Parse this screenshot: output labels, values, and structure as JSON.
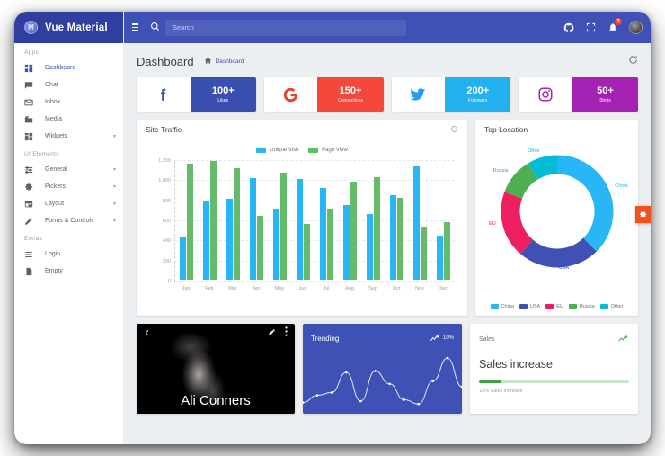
{
  "brand": {
    "logo_letter": "M",
    "title": "Vue Material"
  },
  "sidebar": {
    "sections": [
      {
        "label": "Apps",
        "items": [
          {
            "label": "Dashboard",
            "icon": "dashboard-icon",
            "active": true,
            "expandable": false
          },
          {
            "label": "Chat",
            "icon": "chat-icon",
            "active": false,
            "expandable": false
          },
          {
            "label": "Inbox",
            "icon": "inbox-icon",
            "active": false,
            "expandable": false
          },
          {
            "label": "Media",
            "icon": "media-icon",
            "active": false,
            "expandable": false
          },
          {
            "label": "Widgets",
            "icon": "widgets-icon",
            "active": false,
            "expandable": true
          }
        ]
      },
      {
        "label": "UI Elements",
        "items": [
          {
            "label": "General",
            "icon": "tune-icon",
            "active": false,
            "expandable": true
          },
          {
            "label": "Pickers",
            "icon": "gear-icon",
            "active": false,
            "expandable": true
          },
          {
            "label": "Layout",
            "icon": "layout-icon",
            "active": false,
            "expandable": true
          },
          {
            "label": "Forms & Controls",
            "icon": "pencil-icon",
            "active": false,
            "expandable": true
          }
        ]
      },
      {
        "label": "Extras",
        "items": [
          {
            "label": "Login",
            "icon": "list-icon",
            "active": false,
            "expandable": false
          },
          {
            "label": "Empty",
            "icon": "page-icon",
            "active": false,
            "expandable": false
          }
        ]
      }
    ]
  },
  "topbar": {
    "menu_icon": "hamburger-icon",
    "search_icon": "search-icon",
    "search_value": "",
    "search_placeholder": "Search",
    "github_icon": "github-icon",
    "fullscreen_icon": "fullscreen-icon",
    "notification_icon": "bell-icon",
    "notification_count": "3",
    "avatar": "user-avatar"
  },
  "page": {
    "title": "Dashboard",
    "breadcrumb_home_icon": "home-icon",
    "breadcrumb_label": "Dashboard",
    "refresh_icon": "refresh-icon"
  },
  "social_cards": [
    {
      "network": "facebook",
      "icon": "facebook-icon",
      "value": "100+",
      "label": "Likes",
      "color": "#3b4fb0",
      "icon_color": "#3b5998"
    },
    {
      "network": "google",
      "icon": "google-icon",
      "value": "150+",
      "label": "Connections",
      "color": "#f4483c",
      "icon_color": "#ea4335"
    },
    {
      "network": "twitter",
      "icon": "twitter-icon",
      "value": "200+",
      "label": "Followers",
      "color": "#22b0ef",
      "icon_color": "#1da1f2"
    },
    {
      "network": "instagram",
      "icon": "instagram-icon",
      "value": "50+",
      "label": "Shots",
      "color": "#a321b3",
      "icon_color": "#a321b3"
    }
  ],
  "traffic_card": {
    "title": "Site Traffic",
    "refresh_icon": "refresh-icon"
  },
  "location_card": {
    "title": "Top Location"
  },
  "profile_card": {
    "name": "Ali Conners",
    "back_icon": "chevron-left-icon",
    "edit_icon": "pencil-icon",
    "more_icon": "more-vertical-icon"
  },
  "trending_card": {
    "title": "Trending",
    "percent": "10%",
    "trend_icon": "trend-up-icon"
  },
  "sales_card": {
    "label": "Sales",
    "spark_icon": "trend-up-icon",
    "title": "Sales increase",
    "progress_percent": 15,
    "caption": "15% Sales increase"
  },
  "settings_tab": {
    "icon": "gear-icon",
    "color": "#f4511e"
  },
  "chart_data": [
    {
      "type": "bar",
      "title": "Site Traffic",
      "categories": [
        "Jan",
        "Feb",
        "Mar",
        "Apr",
        "May",
        "Jun",
        "Jul",
        "Aug",
        "Sep",
        "Oct",
        "Nov",
        "Dec"
      ],
      "series": [
        {
          "name": "Unique Visit",
          "color": "#29b6f6",
          "values": [
            415,
            780,
            805,
            1010,
            705,
            1000,
            910,
            740,
            655,
            840,
            1130,
            435
          ]
        },
        {
          "name": "Page View",
          "color": "#66bb6a",
          "values": [
            1155,
            1180,
            1105,
            635,
            1065,
            550,
            705,
            975,
            1015,
            815,
            525,
            575
          ]
        }
      ],
      "xlabel": "",
      "ylabel": "",
      "ylim": [
        0,
        1200
      ],
      "yticks": [
        "0",
        "200",
        "400",
        "600",
        "800",
        "1,000",
        "1,200"
      ],
      "grid": true,
      "legend_position": "top"
    },
    {
      "type": "pie",
      "title": "Top Location",
      "donut": true,
      "labels": [
        "China",
        "USA",
        "EU",
        "Russia",
        "Other"
      ],
      "values": [
        35,
        22,
        18,
        10,
        8
      ],
      "colors": [
        "#29b6f6",
        "#3f51b5",
        "#ec2060",
        "#4caf50",
        "#00bcd4"
      ],
      "legend_position": "bottom"
    },
    {
      "type": "line",
      "title": "Trending",
      "values": [
        8,
        18,
        22,
        50,
        10,
        52,
        34,
        12,
        6,
        38,
        70,
        30
      ],
      "color": "#ffffff"
    }
  ]
}
